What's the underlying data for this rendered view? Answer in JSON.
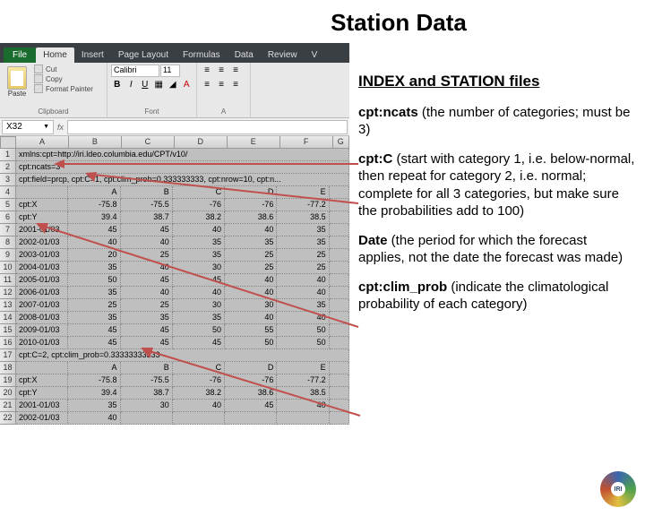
{
  "title": "Station Data",
  "ribbon": {
    "file": "File",
    "tabs": [
      "Home",
      "Insert",
      "Page Layout",
      "Formulas",
      "Data",
      "Review",
      "V"
    ],
    "paste": "Paste",
    "cut": "Cut",
    "copy": "Copy",
    "format_painter": "Format Painter",
    "clipboard_label": "Clipboard",
    "font_name": "Calibri",
    "font_size": "11",
    "font_label": "Font",
    "align_label": "A"
  },
  "cell_ref": "X32",
  "columns": [
    "A",
    "B",
    "C",
    "D",
    "E",
    "F",
    "G"
  ],
  "rows": [
    {
      "n": 1,
      "span": "xmlns:cpt=http://iri.ldeo.columbia.edu/CPT/v10/"
    },
    {
      "n": 2,
      "span": "cpt:ncats=3"
    },
    {
      "n": 3,
      "span": "cpt:field=prcp, cpt:C=1, cpt:clim_prob=0.333333333, cpt:nrow=10, cpt:n..."
    },
    {
      "n": 4,
      "cells": [
        "",
        "A",
        "B",
        "C",
        "D",
        "E"
      ]
    },
    {
      "n": 5,
      "cells": [
        "cpt:X",
        "-75.8",
        "-75.5",
        "-76",
        "-76",
        "-77.2"
      ]
    },
    {
      "n": 6,
      "cells": [
        "cpt:Y",
        "39.4",
        "38.7",
        "38.2",
        "38.6",
        "38.5"
      ]
    },
    {
      "n": 7,
      "cells": [
        "2001-01/03",
        "45",
        "45",
        "40",
        "40",
        "35"
      ]
    },
    {
      "n": 8,
      "cells": [
        "2002-01/03",
        "40",
        "40",
        "35",
        "35",
        "35"
      ]
    },
    {
      "n": 9,
      "cells": [
        "2003-01/03",
        "20",
        "25",
        "35",
        "25",
        "25"
      ]
    },
    {
      "n": 10,
      "cells": [
        "2004-01/03",
        "35",
        "40",
        "30",
        "25",
        "25"
      ]
    },
    {
      "n": 11,
      "cells": [
        "2005-01/03",
        "50",
        "45",
        "45",
        "40",
        "40"
      ]
    },
    {
      "n": 12,
      "cells": [
        "2006-01/03",
        "35",
        "40",
        "40",
        "40",
        "40"
      ]
    },
    {
      "n": 13,
      "cells": [
        "2007-01/03",
        "25",
        "25",
        "30",
        "30",
        "35"
      ]
    },
    {
      "n": 14,
      "cells": [
        "2008-01/03",
        "35",
        "35",
        "35",
        "40",
        "40"
      ]
    },
    {
      "n": 15,
      "cells": [
        "2009-01/03",
        "45",
        "45",
        "50",
        "55",
        "50"
      ]
    },
    {
      "n": 16,
      "cells": [
        "2010-01/03",
        "45",
        "45",
        "45",
        "50",
        "50"
      ]
    },
    {
      "n": 17,
      "span": "cpt:C=2, cpt:clim_prob=0.33333333333"
    },
    {
      "n": 18,
      "cells": [
        "",
        "A",
        "B",
        "C",
        "D",
        "E"
      ]
    },
    {
      "n": 19,
      "cells": [
        "cpt:X",
        "-75.8",
        "-75.5",
        "-76",
        "-76",
        "-77.2"
      ]
    },
    {
      "n": 20,
      "cells": [
        "cpt:Y",
        "39.4",
        "38.7",
        "38.2",
        "38.6",
        "38.5"
      ]
    },
    {
      "n": 21,
      "cells": [
        "2001-01/03",
        "35",
        "30",
        "40",
        "45",
        "40"
      ]
    },
    {
      "n": 22,
      "cells_partial": [
        "2002-01/03",
        "40"
      ]
    }
  ],
  "desc": {
    "heading": "INDEX and STATION files",
    "p1_b": "cpt:ncats",
    "p1": " (the number of categories; must be 3)",
    "p2_b": "cpt:C",
    "p2": " (start with category 1, i.e. below-normal, then repeat for category 2, i.e. normal; complete for all 3 categories, but make sure the probabilities add to 100)",
    "p3_b": "Date",
    "p3": " (the period for which the forecast applies, not the date the forecast was made)",
    "p4_b": "cpt:clim_prob",
    "p4": " (indicate the climatological probability of each category)"
  }
}
